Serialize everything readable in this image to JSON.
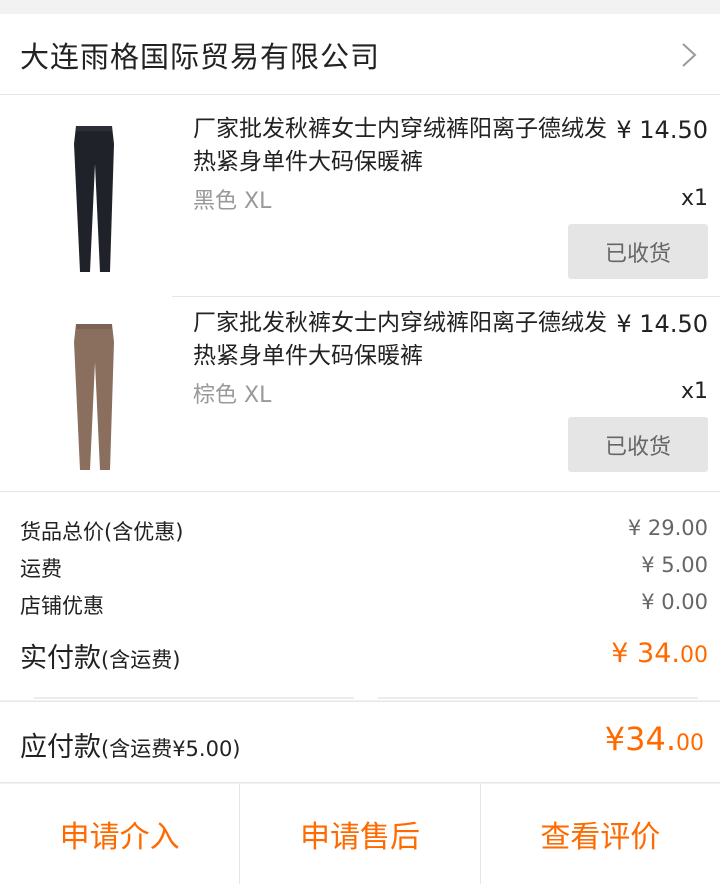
{
  "store": {
    "name": "大连雨格国际贸易有限公司",
    "arrow_icon": "chevron-right-icon"
  },
  "items": [
    {
      "title": "厂家批发秋裤女士内穿绒裤阳离子德绒发热紧身单件大码保暖裤",
      "price": "¥ 14.50",
      "spec": "黑色 XL",
      "qty": "x1",
      "status": "已收货",
      "image_icon": "black-leggings-image",
      "image_color": "#1f2229"
    },
    {
      "title": "厂家批发秋裤女士内穿绒裤阳离子德绒发热紧身单件大码保暖裤",
      "price": "¥ 14.50",
      "spec": "棕色 XL",
      "qty": "x1",
      "status": "已收货",
      "image_icon": "brown-leggings-image",
      "image_color": "#8a6e5e"
    }
  ],
  "summary": {
    "goods_total_label": "货品总价(含优惠)",
    "goods_total_value": "¥ 29.00",
    "shipping_label": "运费",
    "shipping_value": "¥ 5.00",
    "discount_label": "店铺优惠",
    "discount_value": "¥ 0.00",
    "paid_label": "实付款",
    "paid_sub": "(含运费)",
    "paid_int": "¥ 34.",
    "paid_dec": "00"
  },
  "due": {
    "label": "应付款",
    "sub": "(含运费¥5.00)",
    "int": "¥34.",
    "dec": "00"
  },
  "actions": [
    "申请介入",
    "申请售后",
    "查看评价"
  ],
  "colors": {
    "accent": "#ff6a00",
    "status_bg": "#e5e5e5"
  }
}
